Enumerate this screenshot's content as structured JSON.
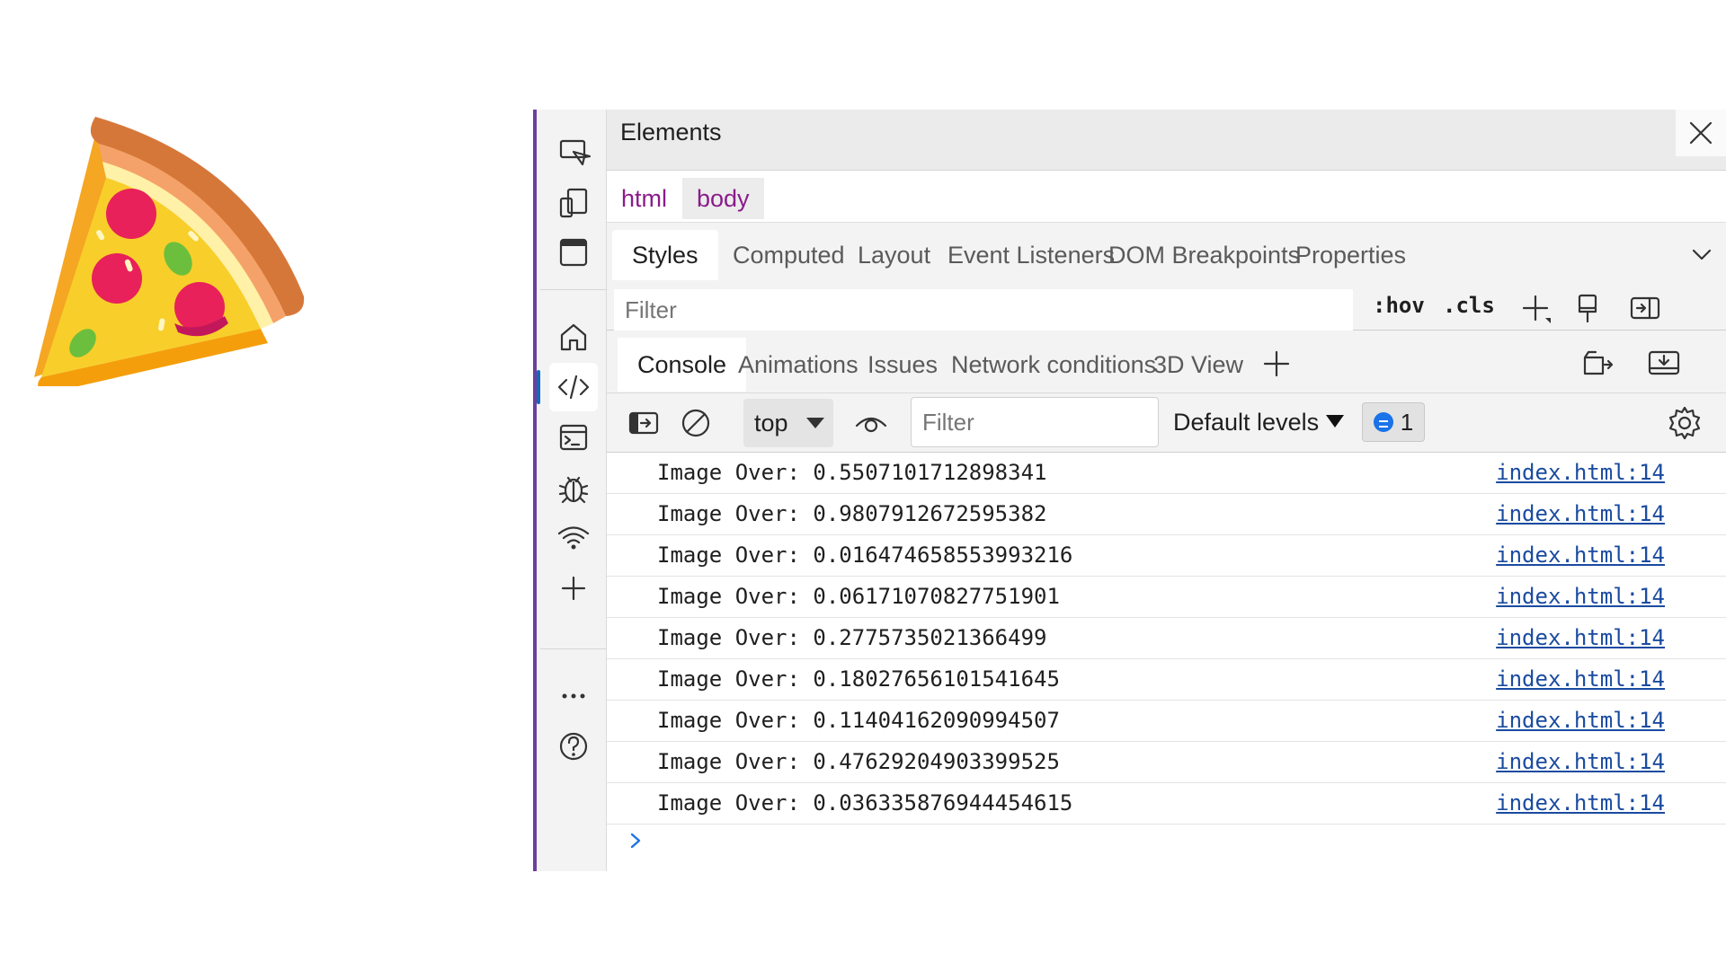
{
  "devtools": {
    "panel_title": "Elements",
    "breadcrumbs": [
      "html",
      "body"
    ],
    "styles_tabs": [
      "Styles",
      "Computed",
      "Layout",
      "Event Listeners",
      "DOM Breakpoints",
      "Properties"
    ],
    "styles_filter_placeholder": "Filter",
    "styles_tools": {
      "hov": ":hov",
      "cls": ".cls"
    },
    "drawer_tabs": [
      "Console",
      "Animations",
      "Issues",
      "Network conditions",
      "3D View"
    ],
    "console": {
      "context": "top",
      "filter_placeholder": "Filter",
      "levels": "Default levels",
      "issues_count": "1",
      "logs": [
        {
          "message": "Image Over: 0.5507101712898341",
          "source": "index.html:14"
        },
        {
          "message": "Image Over: 0.9807912672595382",
          "source": "index.html:14"
        },
        {
          "message": "Image Over: 0.016474658553993216",
          "source": "index.html:14"
        },
        {
          "message": "Image Over: 0.06171070827751901",
          "source": "index.html:14"
        },
        {
          "message": "Image Over: 0.2775735021366499",
          "source": "index.html:14"
        },
        {
          "message": "Image Over: 0.18027656101541645",
          "source": "index.html:14"
        },
        {
          "message": "Image Over: 0.11404162090994507",
          "source": "index.html:14"
        },
        {
          "message": "Image Over: 0.47629204903399525",
          "source": "index.html:14"
        },
        {
          "message": "Image Over: 0.036335876944454615",
          "source": "index.html:14"
        }
      ]
    },
    "activity_icons": [
      "inspect-icon",
      "device-emulation-icon",
      "browser-window-icon",
      "home-icon",
      "code-icon",
      "console-icon",
      "bug-icon",
      "wifi-icon",
      "add-icon",
      "more-icon",
      "help-icon"
    ]
  },
  "colors": {
    "activity_accent": "#6b3fa0",
    "link": "#1a4ba0",
    "crumb": "#8a1c8a",
    "active_indicator": "#0f6cbd"
  }
}
